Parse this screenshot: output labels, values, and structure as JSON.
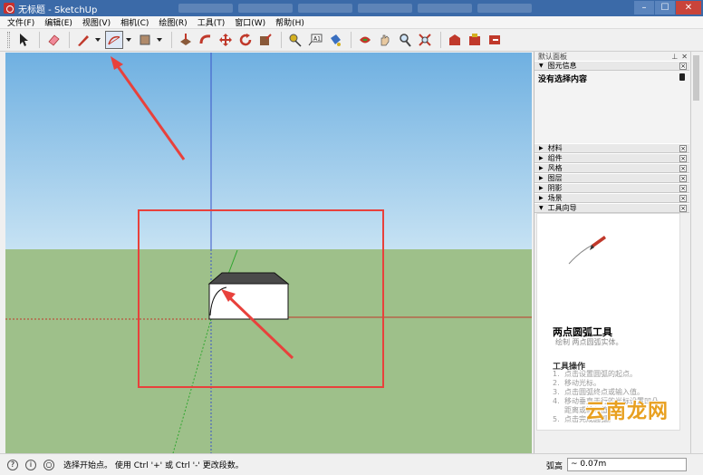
{
  "window": {
    "title": "无标题 - SketchUp",
    "minimize": "–",
    "maximize": "☐",
    "close": "✕"
  },
  "menu": [
    "文件(F)",
    "编辑(E)",
    "视图(V)",
    "相机(C)",
    "绘图(R)",
    "工具(T)",
    "窗口(W)",
    "帮助(H)"
  ],
  "toolbar": {
    "active_tool": "arc-2point-tool"
  },
  "panel": {
    "header": "默认面板",
    "pin": "⊥",
    "close": "✕",
    "entity_info": "图元信息",
    "nothing_selected": "没有选择内容",
    "trays": [
      "材料",
      "组件",
      "风格",
      "图层",
      "阴影",
      "场景"
    ],
    "instructor_label": "工具向导",
    "tool_name": "两点圆弧工具",
    "tool_desc": "绘制 两点圆弧实体。",
    "ops_title": "工具操作",
    "steps": [
      {
        "n": "1.",
        "text": "点击设置圆弧的起点。"
      },
      {
        "n": "2.",
        "text": "移动光标。"
      },
      {
        "n": "3.",
        "text": "点击圆弧终点或输入值。"
      },
      {
        "n": "4.",
        "text": "移动垂直于行的光标设置凹凸"
      },
      {
        "n": "",
        "text": "距离或输入值。"
      },
      {
        "n": "5.",
        "text": "点击完成圆弧。"
      }
    ],
    "watermark": "云南龙网"
  },
  "status": {
    "message": "选择开始点。 使用 Ctrl '+' 或 Ctrl '-' 更改段数。",
    "measure_label": "弧高",
    "measure_value": "~ 0.07m"
  },
  "colors": {
    "sky_top": "#6fb0e1",
    "ground": "#9ec08a",
    "annotation_red": "#e8413c",
    "axis_blue": "#3a55c8",
    "axis_green": "#2fa52f",
    "axis_red": "#c0392b"
  }
}
